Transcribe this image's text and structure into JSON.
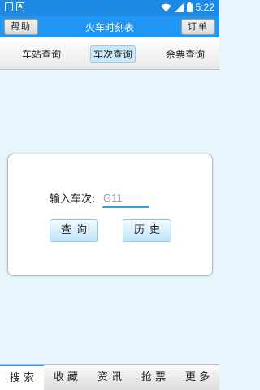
{
  "status_bar": {
    "left_icons": [
      "signal-box-icon",
      "app-a-icon"
    ],
    "left_labels": [
      "",
      "A"
    ],
    "right_icons": [
      "wifi-icon",
      "cellular-icon",
      "battery-icon"
    ],
    "time": "5:22"
  },
  "header": {
    "title": "火车时刻表",
    "help_label": "帮助",
    "order_label": "订单"
  },
  "tabs": [
    {
      "label": "车站查询",
      "active": false
    },
    {
      "label": "车次查询",
      "active": true
    },
    {
      "label": "余票查询",
      "active": false
    }
  ],
  "search": {
    "label": "输入车次:",
    "placeholder": "G11",
    "value": "",
    "query_button": "查询",
    "history_button": "历史"
  },
  "bottom_nav": [
    {
      "label": "搜索",
      "active": true
    },
    {
      "label": "收藏",
      "active": false
    },
    {
      "label": "资讯",
      "active": false
    },
    {
      "label": "抢票",
      "active": false
    },
    {
      "label": "更多",
      "active": false
    }
  ],
  "colors": {
    "status_bar": "#1e88e5",
    "title_bar": "#2196f3",
    "background": "#e6f6fc",
    "accent": "#3aa1e0"
  }
}
